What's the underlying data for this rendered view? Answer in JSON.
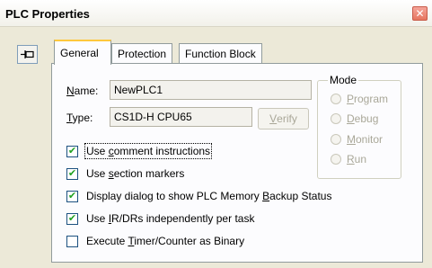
{
  "window": {
    "title": "PLC Properties",
    "close_glyph": "✕"
  },
  "tabs": [
    {
      "label": "General",
      "active": true
    },
    {
      "label": "Protection",
      "active": false
    },
    {
      "label": "Function Block",
      "active": false
    }
  ],
  "general": {
    "name_label_ul": "N",
    "name_label_rest": "ame:",
    "name_value": "NewPLC1",
    "type_label_ul": "T",
    "type_label_rest": "ype:",
    "type_value": "CS1D-H CPU65",
    "verify_ul": "V",
    "verify_rest": "erify"
  },
  "mode": {
    "legend": "Mode",
    "options": [
      {
        "ul": "P",
        "rest": "rogram"
      },
      {
        "ul": "D",
        "rest": "ebug"
      },
      {
        "ul": "M",
        "rest": "onitor"
      },
      {
        "ul": "R",
        "rest": "un"
      }
    ]
  },
  "options": [
    {
      "pre": "Use ",
      "ul": "c",
      "post": "omment instructions",
      "checked": true
    },
    {
      "pre": "Use ",
      "ul": "s",
      "post": "ection markers",
      "checked": true
    },
    {
      "pre": "Display dialog to show PLC Memory ",
      "ul": "B",
      "post": "ackup Status",
      "checked": true
    },
    {
      "pre": "Use ",
      "ul": "I",
      "post": "R/DRs independently per task",
      "checked": true
    },
    {
      "pre": "Execute ",
      "ul": "T",
      "post": "imer/Counter as Binary",
      "checked": false
    }
  ],
  "check_glyph": "✔"
}
